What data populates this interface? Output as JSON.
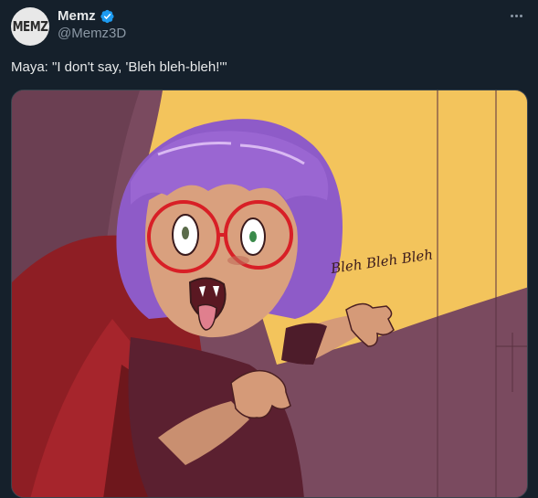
{
  "author": {
    "avatar_text": "MEMZ",
    "display_name": "Memz",
    "handle": "@Memz3D",
    "verified": true,
    "verified_icon": "verified-badge-icon"
  },
  "menu": {
    "icon": "more-horizontal-icon"
  },
  "tweet": {
    "text": "Maya: \"I don't say, 'Bleh bleh-bleh!'\""
  },
  "media": {
    "type": "illustration",
    "caption_art_text": "Bleh Bleh Bleh"
  },
  "colors": {
    "background": "#15202b",
    "text_primary": "#e7e9ea",
    "text_secondary": "#8b98a5",
    "verified_blue": "#1d9bf0",
    "art_wall": "#7a4a5f",
    "art_moon": "#f3c45c",
    "art_hair": "#8e5bc8",
    "art_glasses": "#d81f26"
  }
}
